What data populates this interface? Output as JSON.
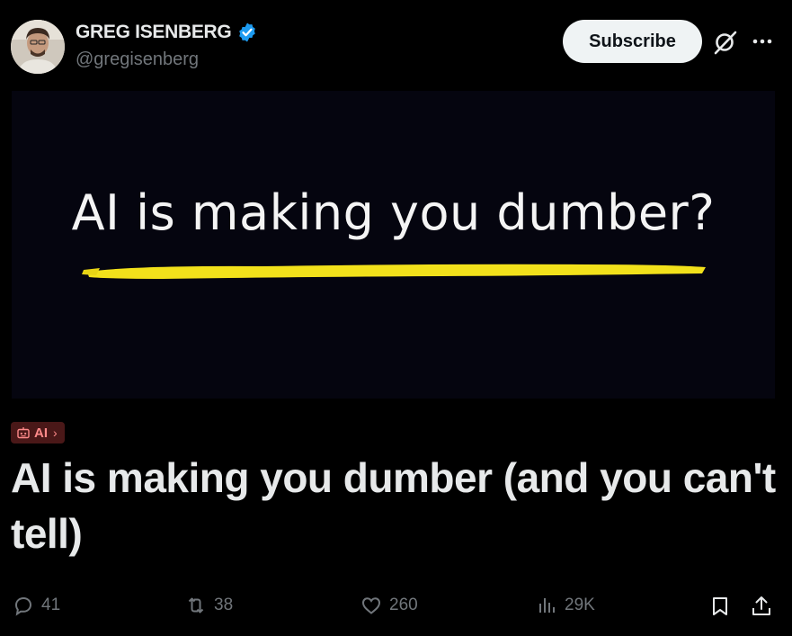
{
  "author": {
    "name": "GREG ISENBERG",
    "handle": "@gregisenberg",
    "verified": true,
    "verified_color": "#1d9bf0"
  },
  "header": {
    "subscribe_label": "Subscribe",
    "grok_icon": "grok-icon",
    "more_icon": "more-horizontal-icon"
  },
  "cover": {
    "text": "AI is making you dumber?",
    "underline_color": "#f2e11b"
  },
  "tag": {
    "label": "AI",
    "chevron": "›",
    "icon": "robot-icon"
  },
  "article": {
    "title": "AI is making you dumber (and you can't tell)"
  },
  "actions": {
    "replies": "41",
    "reposts": "38",
    "likes": "260",
    "views": "29K",
    "bookmark_icon": "bookmark-icon",
    "share_icon": "share-icon"
  },
  "colors": {
    "background": "#000000",
    "text": "#e7e9ea",
    "muted": "#71767b",
    "tag_bg": "#4a1818",
    "tag_text": "#ff8a8a"
  }
}
